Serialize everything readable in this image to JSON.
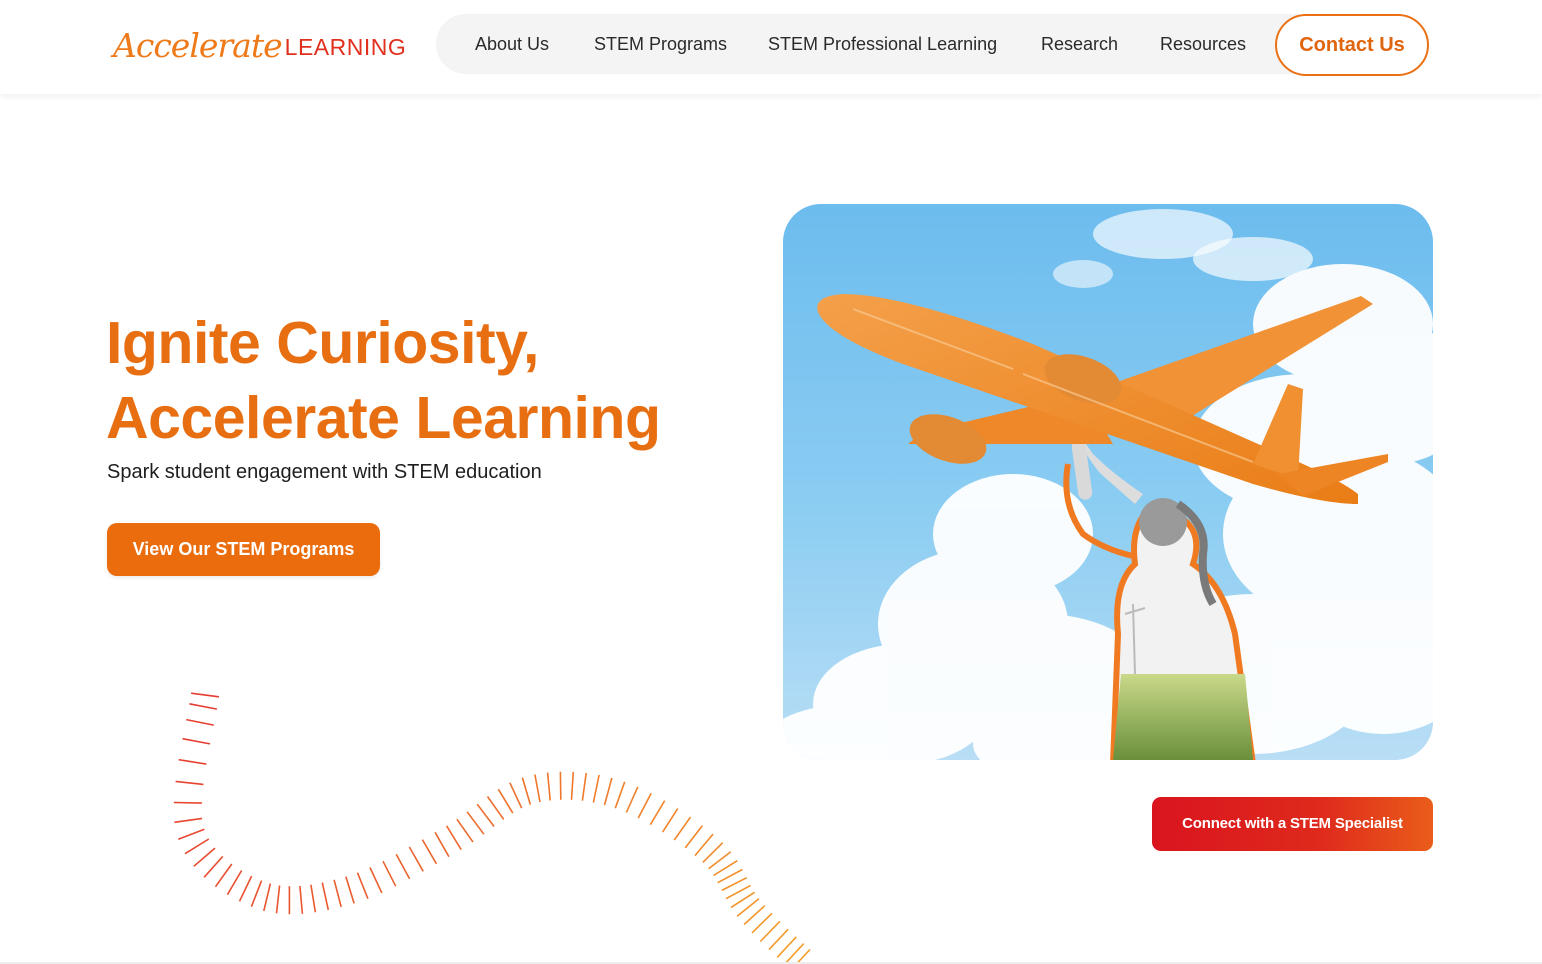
{
  "header": {
    "logo": {
      "script": "Accelerate",
      "caps": "LEARNING"
    },
    "nav": [
      {
        "label": "About Us"
      },
      {
        "label": "STEM Programs"
      },
      {
        "label": "STEM Professional Learning"
      },
      {
        "label": "Research"
      },
      {
        "label": "Resources"
      }
    ],
    "contact_label": "Contact Us"
  },
  "hero": {
    "title_line1": "Ignite Curiosity,",
    "title_line2": "Accelerate Learning",
    "subtitle": "Spark student engagement with STEM education",
    "cta_label": "View Our STEM Programs",
    "specialist_label": "Connect with a STEM Specialist"
  },
  "colors": {
    "brand_orange": "#e86e12",
    "brand_red": "#e0301e",
    "nav_bg": "#f4f4f4",
    "text_dark": "#222222"
  },
  "icons": {
    "hero_image": "girl-launching-airplane-photo",
    "decoration": "tick-wave-decoration"
  }
}
